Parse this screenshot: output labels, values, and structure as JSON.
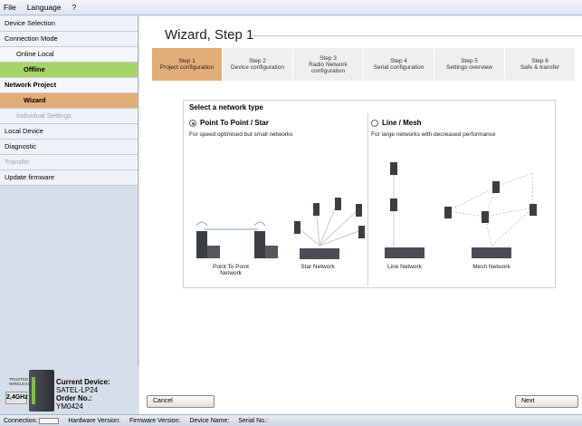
{
  "menu": {
    "file": "File",
    "file_u": "F",
    "language": "Language",
    "language_u": "L",
    "help": "?"
  },
  "sidebar": {
    "items": [
      "Device Selection",
      "Connection Mode",
      "Online Local",
      "Offline",
      "Network Project",
      "Wizard",
      "Individual Settings",
      "Local Device",
      "Diagnostic",
      "Transfer",
      "Update firmware"
    ]
  },
  "device": {
    "brand": "TRUSTED WIRELESS",
    "band": "2,4GHz",
    "current_label": "Current Device:",
    "current_value": "SATEL-LP24",
    "order_label": "Order No.:",
    "order_value": "YM0424"
  },
  "wizard": {
    "title": "Wizard, Step 1",
    "steps": [
      {
        "num": "Step 1",
        "label": "Project configuration"
      },
      {
        "num": "Step 2",
        "label": "Device configuration"
      },
      {
        "num": "Step 3",
        "label": "Radio Network configuration"
      },
      {
        "num": "Step 4",
        "label": "Serial configuration"
      },
      {
        "num": "Step 5",
        "label": "Settings overview"
      },
      {
        "num": "Step 6",
        "label": "Safe & transfer"
      }
    ],
    "select_title": "Select a network type",
    "option1": {
      "label": "Point To Point / Star",
      "desc": "For speed optimised but small networks"
    },
    "option2": {
      "label": "Line / Mesh",
      "desc": "For large networks with decreased performance"
    },
    "labels": {
      "ptp": "Point To Point Network",
      "star": "Star Network",
      "line": "Line Network",
      "mesh": "Mesh Network"
    }
  },
  "buttons": {
    "cancel": "Cancel",
    "cancel_u": "C",
    "next": "Next",
    "next_u": "N"
  },
  "status": {
    "connection": "Connection:",
    "hardware": "Hardware Version:",
    "firmware": "Firmware Version:",
    "device_name": "Device Name:",
    "serial": "Serial No.:"
  },
  "colors": {
    "active": "#e3ad78",
    "offline": "#a6d36a",
    "radio": "#1f63b4"
  }
}
